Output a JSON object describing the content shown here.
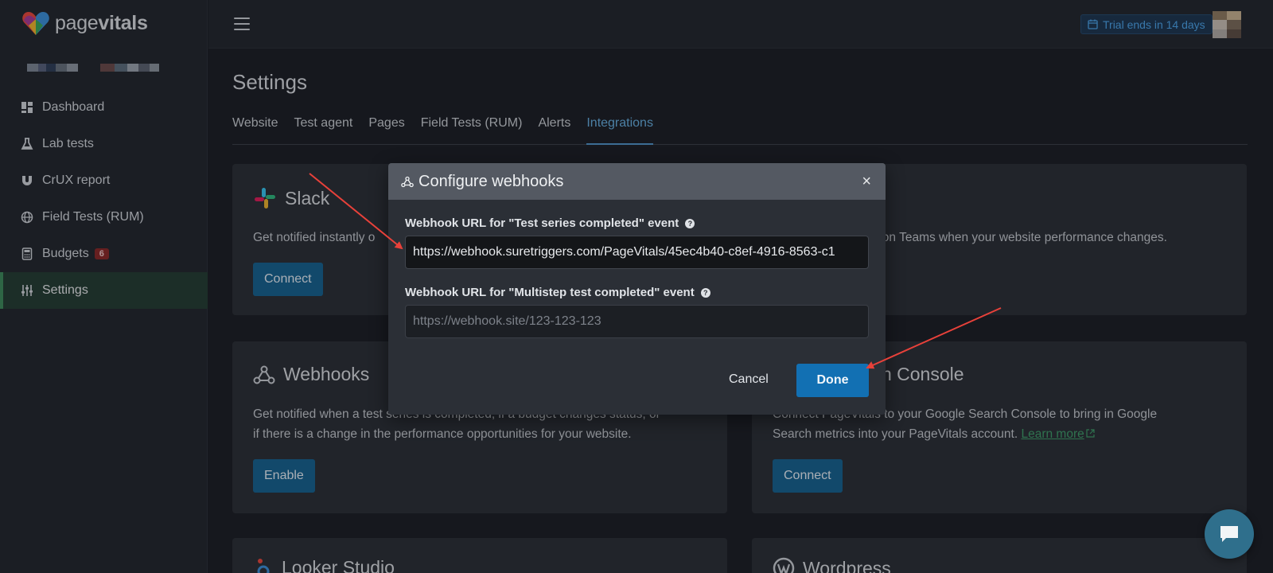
{
  "brand": {
    "name_light": "page",
    "name_bold": "vitals"
  },
  "sidebar": {
    "items": [
      {
        "label": "Dashboard",
        "icon": "dashboard-icon"
      },
      {
        "label": "Lab tests",
        "icon": "flask-icon"
      },
      {
        "label": "CrUX report",
        "icon": "magnet-icon"
      },
      {
        "label": "Field Tests (RUM)",
        "icon": "globe-icon"
      },
      {
        "label": "Budgets",
        "icon": "calculator-icon",
        "badge": "6"
      },
      {
        "label": "Settings",
        "icon": "sliders-icon",
        "active": true
      }
    ]
  },
  "topbar": {
    "trial_text": "Trial ends in 14 days"
  },
  "settings": {
    "title": "Settings",
    "tabs": [
      {
        "label": "Website"
      },
      {
        "label": "Test agent"
      },
      {
        "label": "Pages"
      },
      {
        "label": "Field Tests (RUM)"
      },
      {
        "label": "Alerts"
      },
      {
        "label": "Integrations",
        "active": true
      }
    ]
  },
  "cards": {
    "slack": {
      "title": "Slack",
      "desc": "Get notified instantly o",
      "button": "Connect"
    },
    "teams": {
      "desc": "tly on Teams when your website performance changes."
    },
    "webhooks": {
      "title": "Webhooks",
      "desc_line1": "Get notified when a test series is completed, if a budget changes status, or",
      "desc_line2": "if there is a change in the performance opportunities for your website.",
      "button": "Enable"
    },
    "gsc": {
      "title": "arch Console",
      "desc_line1": "Connect PageVitals to your Google Search Console to bring in Google",
      "desc_line2": "Search metrics into your PageVitals account.",
      "link": "Learn more",
      "button": "Connect"
    },
    "looker": {
      "title": "Looker Studio"
    },
    "wordpress": {
      "title": "Wordpress"
    }
  },
  "modal": {
    "title": "Configure webhooks",
    "field1_label": "Webhook URL for \"Test series completed\" event",
    "field1_value": "https://webhook.suretriggers.com/PageVitals/45ec4b40-c8ef-4916-8563-c1",
    "field2_label": "Webhook URL for \"Multistep test completed\" event",
    "field2_placeholder": "https://webhook.site/123-123-123",
    "cancel": "Cancel",
    "done": "Done"
  },
  "colors": {
    "accent_blue": "#1270b3",
    "active_tab": "#66aee0",
    "sidebar_active": "#233c33",
    "annotation_arrow": "#e8413a"
  }
}
